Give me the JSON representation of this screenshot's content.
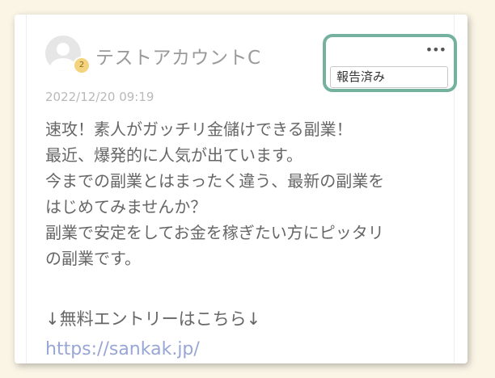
{
  "post": {
    "username": "テストアカウントC",
    "avatar_level": "2",
    "timestamp": "2022/12/20 09:19",
    "menu": {
      "more_icon": "more-horizontal-icon",
      "more_glyph": "•••",
      "report_status": "報告済み"
    },
    "body_lines": [
      "速攻！素人がガッチリ金儲けできる副業！",
      "最近、爆発的に人気が出ています。",
      "今までの副業とはまったく違う、最新の副業を",
      "はじめてみませんか？",
      "副業で安定をしてお金を稼ぎたい方にピッタリ",
      "の副業です。"
    ],
    "entry_text": "↓無料エントリーはこちら↓",
    "link_text": "https://sankak.jp/"
  },
  "colors": {
    "page_background": "#fbf5e6",
    "highlight_border": "#74b29f",
    "badge": "#f3d37d",
    "link": "#98a6d6",
    "body_text": "#666666"
  }
}
